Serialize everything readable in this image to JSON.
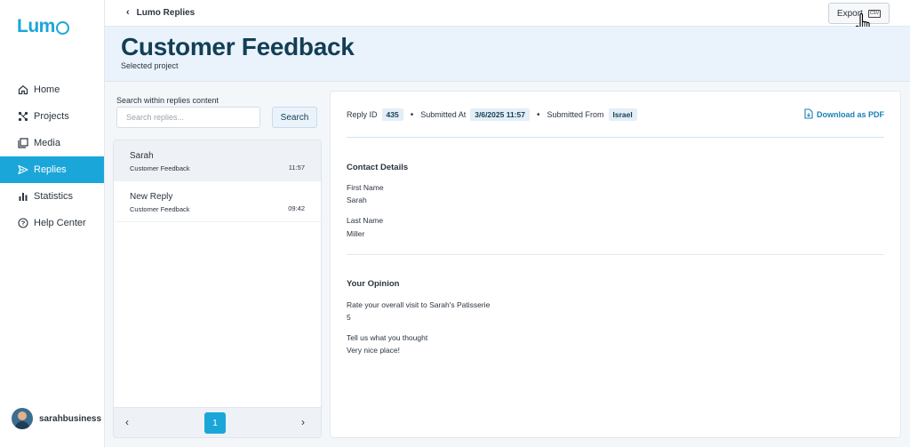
{
  "sidebar": {
    "logo": "Lum",
    "items": [
      {
        "label": "Home",
        "icon": "home-icon"
      },
      {
        "label": "Projects",
        "icon": "projects-icon"
      },
      {
        "label": "Media",
        "icon": "media-icon"
      },
      {
        "label": "Replies",
        "icon": "replies-icon",
        "active": true
      },
      {
        "label": "Statistics",
        "icon": "statistics-icon"
      },
      {
        "label": "Help Center",
        "icon": "help-icon"
      }
    ],
    "user": "sarahbusiness"
  },
  "topbar": {
    "back_label": "Lumo Replies",
    "export_label": "Export",
    "export_icon_text": "CSV"
  },
  "header": {
    "title": "Customer Feedback",
    "subtitle": "Selected project"
  },
  "search": {
    "label": "Search within replies content",
    "placeholder": "Search replies...",
    "button": "Search"
  },
  "replies": [
    {
      "name": "Sarah",
      "project": "Customer Feedback",
      "time": "11:57",
      "selected": true
    },
    {
      "name": "New Reply",
      "project": "Customer Feedback",
      "time": "09:42",
      "selected": false
    }
  ],
  "pager": {
    "current_page": "1",
    "prev": "‹",
    "next": "›"
  },
  "detail": {
    "reply_id_label": "Reply ID",
    "reply_id": "435",
    "submitted_at_label": "Submitted At",
    "submitted_at": "3/6/2025 11:57",
    "submitted_from_label": "Submitted From",
    "submitted_from": "Israel",
    "download_label": "Download as PDF",
    "sections": [
      {
        "title": "Contact Details",
        "fields": [
          {
            "label": "First Name",
            "value": "Sarah"
          },
          {
            "label": "Last Name",
            "value": "Miller"
          }
        ]
      },
      {
        "title": "Your Opinion",
        "fields": [
          {
            "label": "Rate your overall visit to Sarah's Patisserie",
            "value": "5"
          },
          {
            "label": "Tell us what you thought",
            "value": "Very nice place!"
          }
        ]
      }
    ]
  },
  "colors": {
    "accent": "#1ba6d9",
    "title": "#133e56",
    "header_bg": "#eaf3fb",
    "link": "#1b7fb8"
  }
}
